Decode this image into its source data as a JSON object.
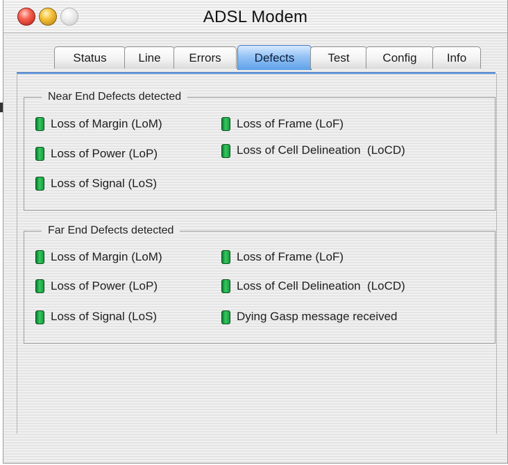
{
  "window": {
    "title": "ADSL Modem"
  },
  "tabs": [
    {
      "label": "Status",
      "active": false
    },
    {
      "label": "Line",
      "active": false
    },
    {
      "label": "Errors",
      "active": false
    },
    {
      "label": "Defects",
      "active": true
    },
    {
      "label": "Test",
      "active": false
    },
    {
      "label": "Config",
      "active": false
    },
    {
      "label": "Info",
      "active": false
    }
  ],
  "near_end": {
    "legend": "Near End Defects detected",
    "items": [
      {
        "label": "Loss of Margin (LoM)",
        "led": "green"
      },
      {
        "label": "Loss of Frame (LoF)",
        "led": "green"
      },
      {
        "label": "Loss of Power (LoP)",
        "led": "green"
      },
      {
        "label": "Loss of Cell Delineation  (LoCD)",
        "led": "green"
      },
      {
        "label": "Loss of Signal (LoS)",
        "led": "green"
      }
    ]
  },
  "far_end": {
    "legend": "Far End Defects detected",
    "items": [
      {
        "label": "Loss of Margin (LoM)",
        "led": "green"
      },
      {
        "label": "Loss of Frame (LoF)",
        "led": "green"
      },
      {
        "label": "Loss of Power (LoP)",
        "led": "green"
      },
      {
        "label": "Loss of Cell Delineation  (LoCD)",
        "led": "green"
      },
      {
        "label": "Loss of Signal (LoS)",
        "led": "green"
      },
      {
        "label": "Dying Gasp message received",
        "led": "green"
      }
    ]
  },
  "colors": {
    "led_green": "#2bb652",
    "active_tab": "#5fa1e8",
    "tab_underline": "#6e9fde"
  }
}
